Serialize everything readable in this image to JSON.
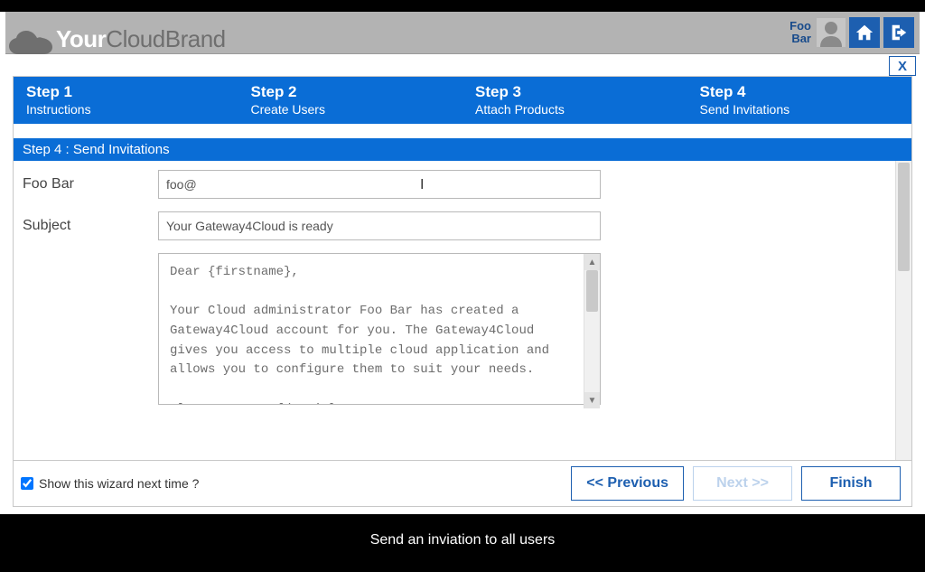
{
  "brand": {
    "bold": "Your",
    "rest": "CloudBrand"
  },
  "user": {
    "first": "Foo",
    "last": "Bar"
  },
  "icons": {
    "home": "home-icon",
    "logout": "logout-icon",
    "avatar": "avatar-icon",
    "close": "X"
  },
  "steps": [
    {
      "title": "Step 1",
      "sub": "Instructions"
    },
    {
      "title": "Step 2",
      "sub": "Create Users"
    },
    {
      "title": "Step 3",
      "sub": "Attach Products"
    },
    {
      "title": "Step 4",
      "sub": "Send Invitations"
    }
  ],
  "section_title": "Step 4 : Send Invitations",
  "form": {
    "recipient_label": "Foo Bar",
    "recipient_value": "foo@",
    "subject_label": "Subject",
    "subject_value": "Your Gateway4Cloud is ready",
    "message": "Dear {firstname},\n\nYour Cloud administrator Foo Bar has created a Gateway4Cloud account for you. The Gateway4Cloud gives you access to multiple cloud application and allows you to configure them to suit your needs.\n\nPlease go to: {domain}\nUsername: {username}"
  },
  "footer": {
    "checkbox_label": "Show this wizard next time ?",
    "checkbox_checked": true,
    "prev": "<<  Previous",
    "next": "Next  >>",
    "finish": "Finish"
  },
  "caption": "Send an inviation to all users"
}
